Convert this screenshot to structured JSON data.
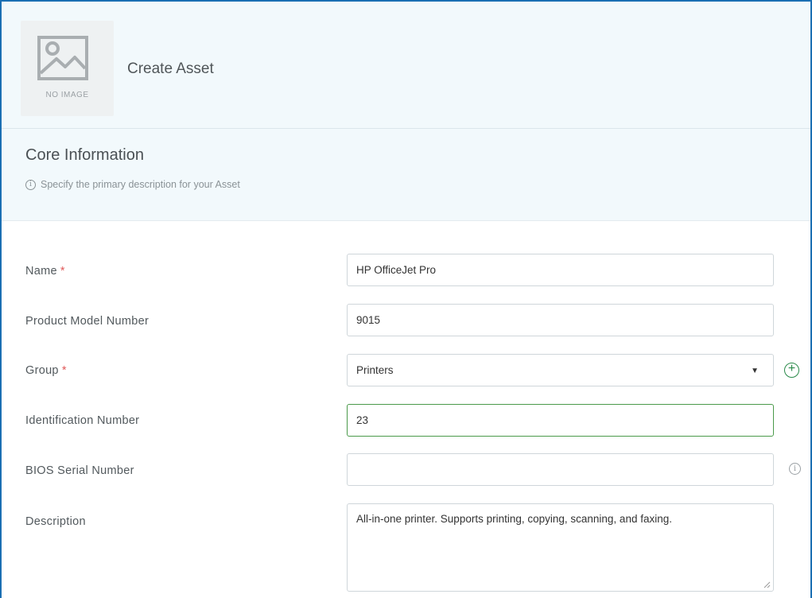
{
  "header": {
    "thumbnail_text": "NO IMAGE",
    "title": "Create Asset"
  },
  "section": {
    "title": "Core Information",
    "subtitle": "Specify the primary description for your Asset"
  },
  "form": {
    "name": {
      "label": "Name",
      "required": "*",
      "value": "HP OfficeJet Pro"
    },
    "model": {
      "label": "Product Model Number",
      "value": "9015"
    },
    "group": {
      "label": "Group",
      "required": "*",
      "value": "Printers"
    },
    "identification": {
      "label": "Identification Number",
      "value": "23"
    },
    "bios": {
      "label": "BIOS Serial Number",
      "value": ""
    },
    "description": {
      "label": "Description",
      "value": "All-in-one printer. Supports printing, copying, scanning, and faxing."
    }
  },
  "icons": {
    "thumbnail": "image-placeholder-icon",
    "info": "info-icon",
    "add": "plus-circle-icon",
    "dropdown": "caret-down-icon"
  },
  "colors": {
    "frame_border": "#1b6fb3",
    "header_bg": "#f2f9fc",
    "required": "#e05a5a",
    "focus_border": "#4a9a4a",
    "add_icon": "#2a8a4a"
  }
}
